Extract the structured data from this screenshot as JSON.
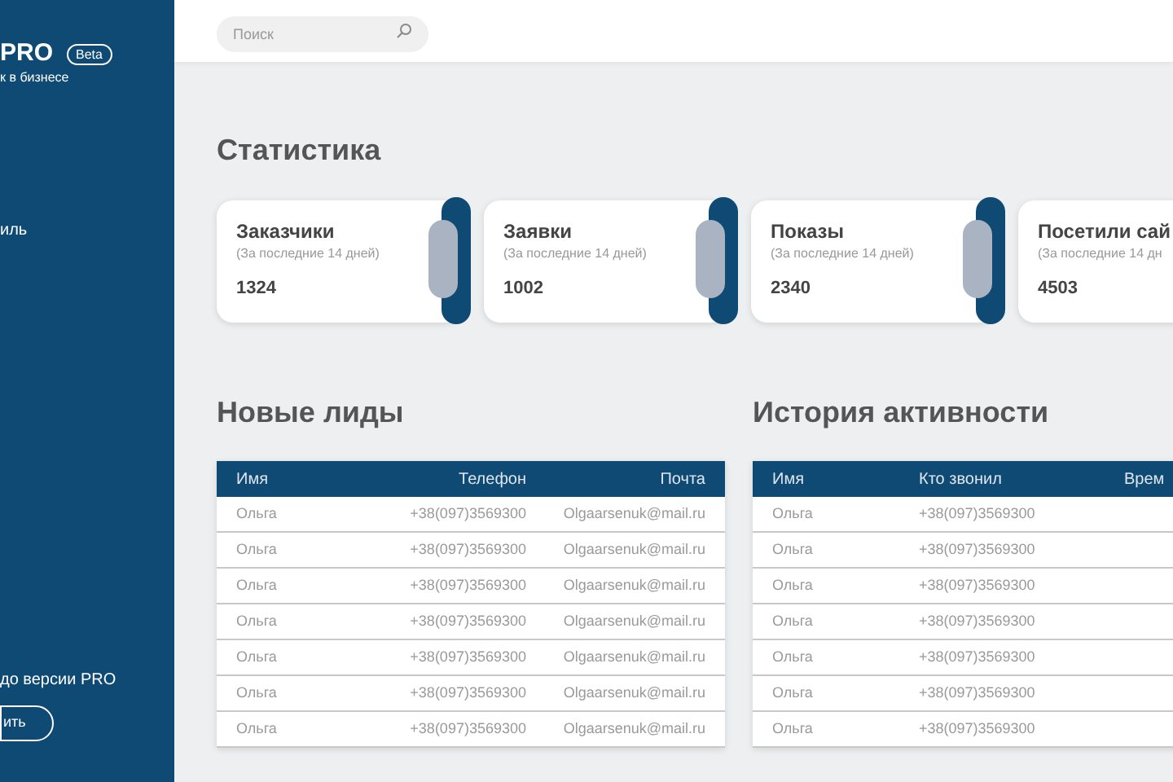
{
  "sidebar": {
    "logo": "PRO",
    "badge": "Beta",
    "tagline": "к в бизнесе",
    "menu": [
      {
        "label": "иль"
      }
    ],
    "promo": "до версии PRO",
    "promo_button": "ить"
  },
  "search": {
    "placeholder": "Поиск"
  },
  "stats": {
    "title": "Статистика",
    "cards": [
      {
        "title": "Заказчики",
        "subtitle": "(За последние 14 дней)",
        "value": "1324"
      },
      {
        "title": "Заявки",
        "subtitle": "(За последние 14 дней)",
        "value": "1002"
      },
      {
        "title": "Показы",
        "subtitle": "(За последние 14 дней)",
        "value": "2340"
      },
      {
        "title": "Посетили сай",
        "subtitle": "(За последние 14 дн",
        "value": "4503"
      }
    ]
  },
  "leads": {
    "title": "Новые лиды",
    "columns": [
      "Имя",
      "Телефон",
      "Почта"
    ],
    "rows": [
      [
        "Ольга",
        "+38(097)3569300",
        "Olgaarsenuk@mail.ru"
      ],
      [
        "Ольга",
        "+38(097)3569300",
        "Olgaarsenuk@mail.ru"
      ],
      [
        "Ольга",
        "+38(097)3569300",
        "Olgaarsenuk@mail.ru"
      ],
      [
        "Ольга",
        "+38(097)3569300",
        "Olgaarsenuk@mail.ru"
      ],
      [
        "Ольга",
        "+38(097)3569300",
        "Olgaarsenuk@mail.ru"
      ],
      [
        "Ольга",
        "+38(097)3569300",
        "Olgaarsenuk@mail.ru"
      ],
      [
        "Ольга",
        "+38(097)3569300",
        "Olgaarsenuk@mail.ru"
      ]
    ]
  },
  "activity": {
    "title": "История активности",
    "columns": [
      "Имя",
      "Кто звонил",
      "Врем"
    ],
    "rows": [
      [
        "Ольга",
        "+38(097)3569300"
      ],
      [
        "Ольга",
        "+38(097)3569300"
      ],
      [
        "Ольга",
        "+38(097)3569300"
      ],
      [
        "Ольга",
        "+38(097)3569300"
      ],
      [
        "Ольга",
        "+38(097)3569300"
      ],
      [
        "Ольга",
        "+38(097)3569300"
      ],
      [
        "Ольга",
        "+38(097)3569300"
      ]
    ]
  }
}
